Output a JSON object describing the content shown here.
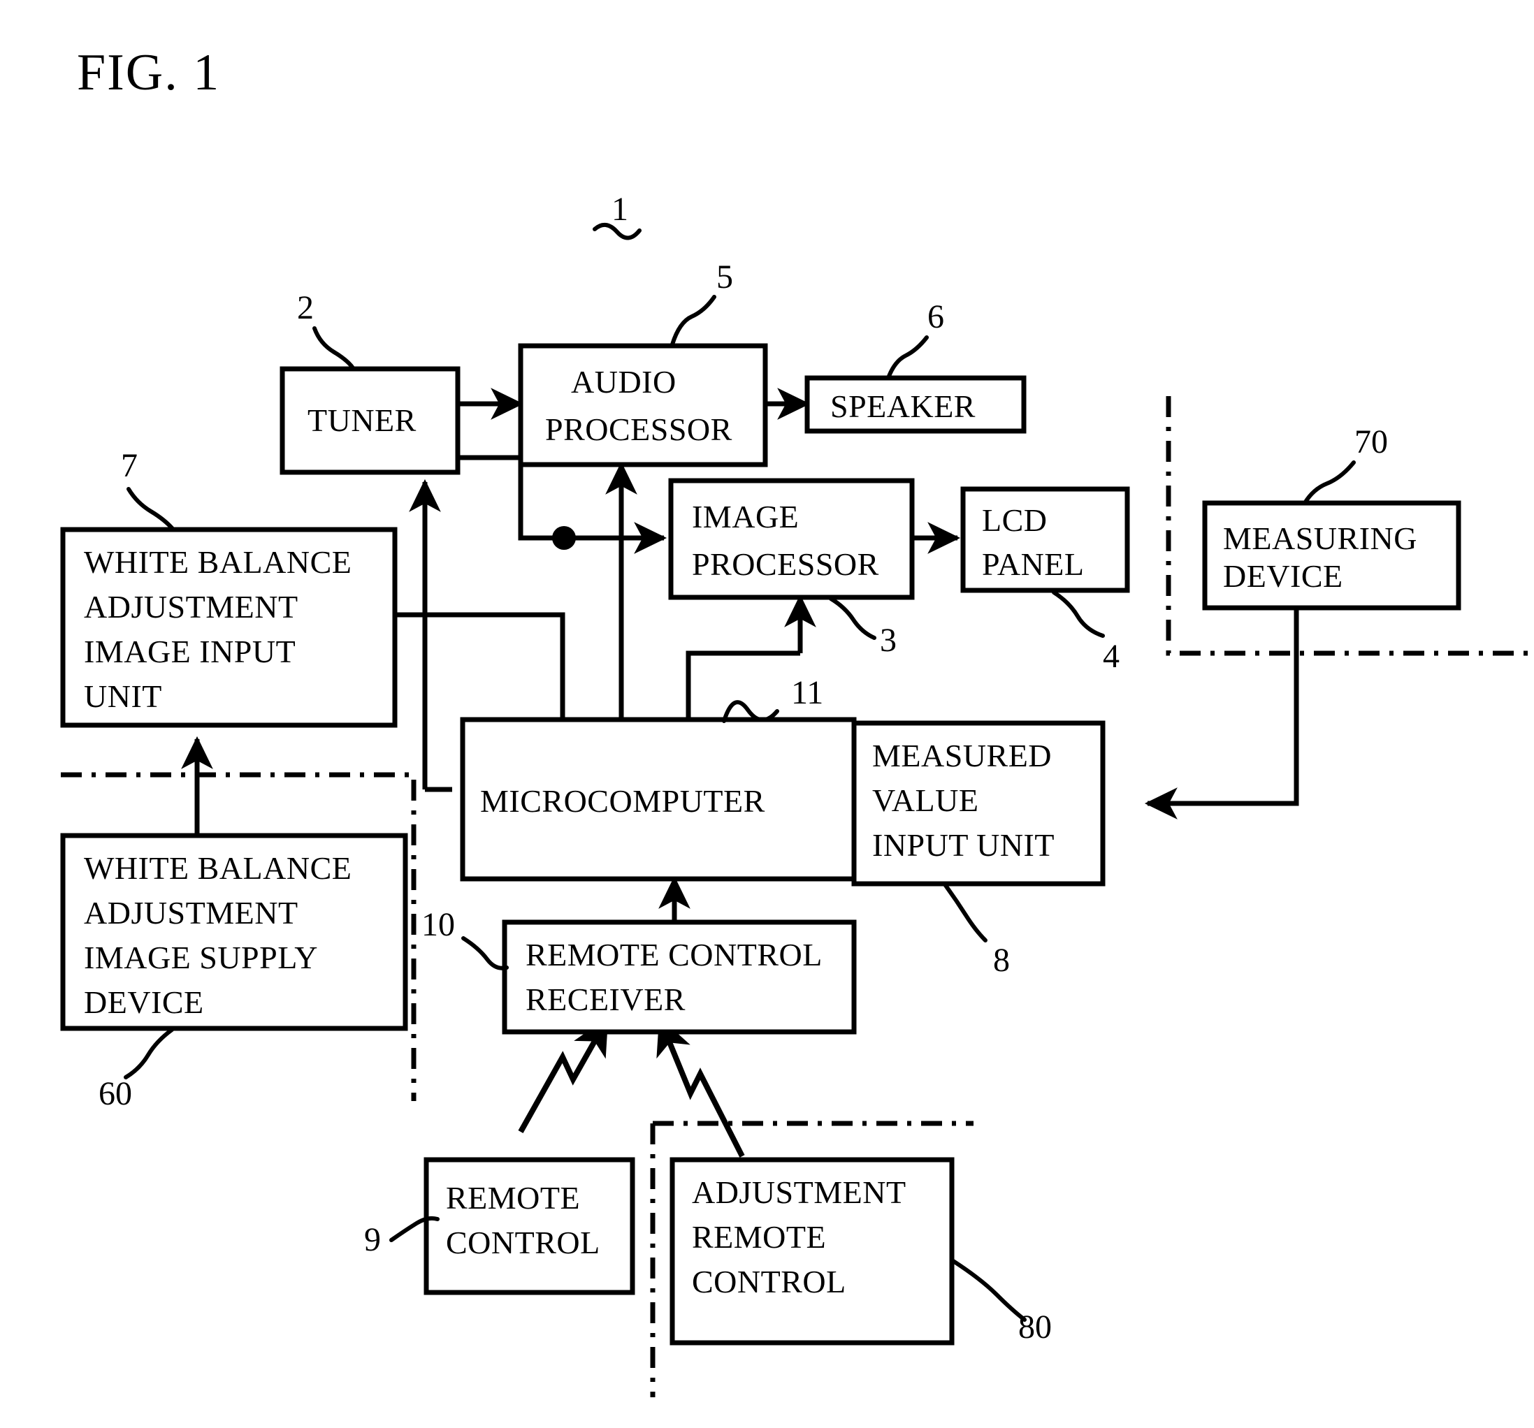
{
  "figure": {
    "title": "FIG. 1"
  },
  "blocks": {
    "tuner": {
      "lines": [
        "TUNER"
      ],
      "ref": "2"
    },
    "audio_processor": {
      "lines": [
        "AUDIO",
        "PROCESSOR"
      ],
      "ref": "5"
    },
    "speaker": {
      "lines": [
        "SPEAKER"
      ],
      "ref": "6"
    },
    "image_processor": {
      "lines": [
        "IMAGE",
        "PROCESSOR"
      ],
      "ref": "3"
    },
    "lcd_panel": {
      "lines": [
        "LCD",
        "PANEL"
      ],
      "ref": "4"
    },
    "wb_image_input_unit": {
      "lines": [
        "WHITE BALANCE",
        "ADJUSTMENT",
        "IMAGE INPUT",
        "UNIT"
      ],
      "ref": "7"
    },
    "wb_image_supply_device": {
      "lines": [
        "WHITE BALANCE",
        "ADJUSTMENT",
        "IMAGE SUPPLY",
        "DEVICE"
      ],
      "ref": "60"
    },
    "microcomputer": {
      "lines": [
        "MICROCOMPUTER"
      ],
      "ref": "11"
    },
    "measured_value_input_unit": {
      "lines": [
        "MEASURED",
        "VALUE",
        "INPUT UNIT"
      ],
      "ref": "8"
    },
    "measuring_device": {
      "lines": [
        "MEASURING",
        "DEVICE"
      ],
      "ref": "70"
    },
    "remote_control_receiver": {
      "lines": [
        "REMOTE CONTROL",
        "RECEIVER"
      ],
      "ref": "10"
    },
    "remote_control": {
      "lines": [
        "REMOTE",
        "CONTROL"
      ],
      "ref": "9"
    },
    "adjustment_remote_control": {
      "lines": [
        "ADJUSTMENT",
        "REMOTE",
        "CONTROL"
      ],
      "ref": "80"
    }
  },
  "system_ref": "1",
  "colors": {
    "ink": "#000000",
    "paper": "#ffffff"
  }
}
